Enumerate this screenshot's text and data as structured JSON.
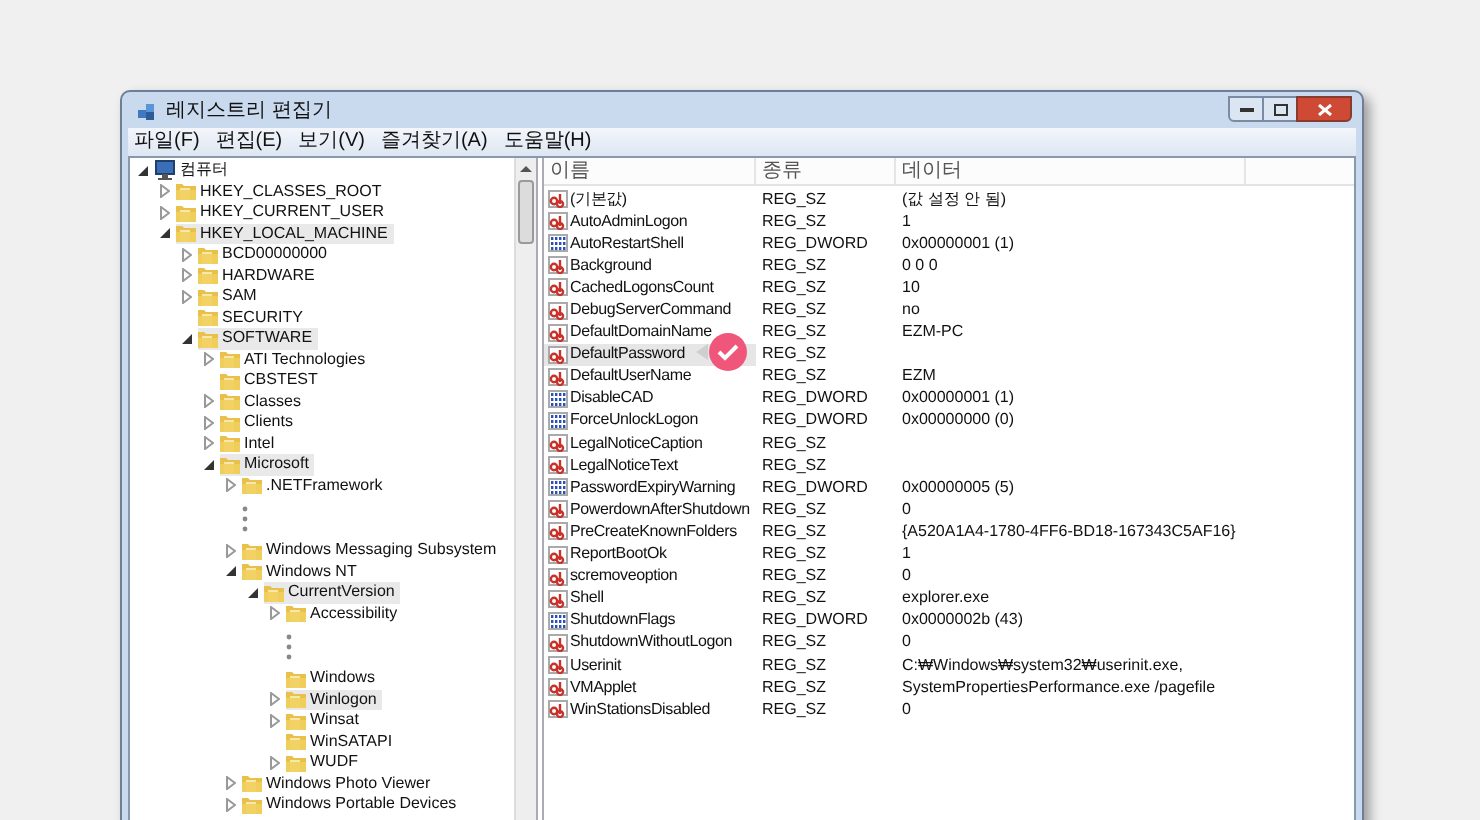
{
  "window": {
    "title": "레지스트리 편집기"
  },
  "menu": [
    "파일(F)",
    "편집(E)",
    "보기(V)",
    "즐겨찾기(A)",
    "도움말(H)"
  ],
  "tree": [
    {
      "kind": "computer",
      "label": "컴퓨터",
      "expandable": true,
      "expanded": true,
      "highlighted": false,
      "children": [
        {
          "kind": "folder",
          "label": "HKEY_CLASSES_ROOT",
          "expandable": true,
          "expanded": false,
          "highlighted": false
        },
        {
          "kind": "folder",
          "label": "HKEY_CURRENT_USER",
          "expandable": true,
          "expanded": false,
          "highlighted": false
        },
        {
          "kind": "folder",
          "label": "HKEY_LOCAL_MACHINE",
          "expandable": true,
          "expanded": true,
          "highlighted": true,
          "children": [
            {
              "kind": "folder",
              "label": "BCD00000000",
              "expandable": true,
              "expanded": false,
              "highlighted": false
            },
            {
              "kind": "folder",
              "label": "HARDWARE",
              "expandable": true,
              "expanded": false,
              "highlighted": false
            },
            {
              "kind": "folder",
              "label": "SAM",
              "expandable": true,
              "expanded": false,
              "highlighted": false
            },
            {
              "kind": "folder",
              "label": "SECURITY",
              "expandable": false,
              "highlighted": false
            },
            {
              "kind": "folder",
              "label": "SOFTWARE",
              "expandable": true,
              "expanded": true,
              "highlighted": true,
              "children": [
                {
                  "kind": "folder",
                  "label": "ATI Technologies",
                  "expandable": true,
                  "expanded": false,
                  "highlighted": false
                },
                {
                  "kind": "folder",
                  "label": "CBSTEST",
                  "expandable": false,
                  "highlighted": false
                },
                {
                  "kind": "folder",
                  "label": "Classes",
                  "expandable": true,
                  "expanded": false,
                  "highlighted": false
                },
                {
                  "kind": "folder",
                  "label": "Clients",
                  "expandable": true,
                  "expanded": false,
                  "highlighted": false
                },
                {
                  "kind": "folder",
                  "label": "Intel",
                  "expandable": true,
                  "expanded": false,
                  "highlighted": false
                },
                {
                  "kind": "folder",
                  "label": "Microsoft",
                  "expandable": true,
                  "expanded": true,
                  "highlighted": true,
                  "children": [
                    {
                      "kind": "folder",
                      "label": ".NETFramework",
                      "expandable": true,
                      "expanded": false,
                      "highlighted": false
                    },
                    {
                      "kind": "gap"
                    },
                    {
                      "kind": "folder",
                      "label": "Windows Messaging Subsystem",
                      "expandable": true,
                      "expanded": false,
                      "highlighted": false
                    },
                    {
                      "kind": "folder",
                      "label": "Windows NT",
                      "expandable": true,
                      "expanded": true,
                      "highlighted": false,
                      "children": [
                        {
                          "kind": "folder",
                          "label": "CurrentVersion",
                          "expandable": true,
                          "expanded": true,
                          "highlighted": true,
                          "children": [
                            {
                              "kind": "folder",
                              "label": "Accessibility",
                              "expandable": true,
                              "expanded": false,
                              "highlighted": false
                            },
                            {
                              "kind": "gap"
                            },
                            {
                              "kind": "folder",
                              "label": "Windows",
                              "expandable": false,
                              "highlighted": false
                            },
                            {
                              "kind": "folder",
                              "label": "Winlogon",
                              "expandable": true,
                              "expanded": false,
                              "highlighted": true
                            },
                            {
                              "kind": "folder",
                              "label": "Winsat",
                              "expandable": true,
                              "expanded": false,
                              "highlighted": false
                            },
                            {
                              "kind": "folder",
                              "label": "WinSATAPI",
                              "expandable": false,
                              "highlighted": false
                            },
                            {
                              "kind": "folder",
                              "label": "WUDF",
                              "expandable": true,
                              "expanded": false,
                              "highlighted": false
                            }
                          ]
                        }
                      ]
                    },
                    {
                      "kind": "folder",
                      "label": "Windows Photo Viewer",
                      "expandable": true,
                      "expanded": false,
                      "highlighted": false
                    },
                    {
                      "kind": "folder",
                      "label": "Windows Portable Devices",
                      "expandable": true,
                      "expanded": false,
                      "highlighted": false
                    }
                  ]
                }
              ]
            }
          ]
        }
      ]
    }
  ],
  "columns": [
    "이름",
    "종류",
    "데이터"
  ],
  "rows": [
    {
      "kind": "string",
      "name": "(기본값)",
      "type": "REG_SZ",
      "data": "(값 설정 안 됨)",
      "selected": false
    },
    {
      "kind": "string",
      "name": "AutoAdminLogon",
      "type": "REG_SZ",
      "data": "1",
      "selected": false
    },
    {
      "kind": "dword",
      "name": "AutoRestartShell",
      "type": "REG_DWORD",
      "data": "0x00000001 (1)",
      "selected": false
    },
    {
      "kind": "string",
      "name": "Background",
      "type": "REG_SZ",
      "data": "0 0 0",
      "selected": false
    },
    {
      "kind": "string",
      "name": "CachedLogonsCount",
      "type": "REG_SZ",
      "data": "10",
      "selected": false
    },
    {
      "kind": "string",
      "name": "DebugServerCommand",
      "type": "REG_SZ",
      "data": "no",
      "selected": false
    },
    {
      "kind": "string",
      "name": "DefaultDomainName",
      "type": "REG_SZ",
      "data": "EZM-PC",
      "selected": false
    },
    {
      "kind": "string",
      "name": "DefaultPassword",
      "type": "REG_SZ",
      "selected": true
    },
    {
      "kind": "string",
      "name": "DefaultUserName",
      "type": "REG_SZ",
      "data": "EZM",
      "selected": false
    },
    {
      "kind": "dword",
      "name": "DisableCAD",
      "type": "REG_DWORD",
      "data": "0x00000001 (1)",
      "selected": false
    },
    {
      "kind": "dword",
      "name": "ForceUnlockLogon",
      "type": "REG_DWORD",
      "data": "0x00000000 (0)",
      "selected": false
    },
    {
      "kind": "string",
      "name": "LegalNoticeCaption",
      "type": "REG_SZ",
      "selected": false
    },
    {
      "kind": "string",
      "name": "LegalNoticeText",
      "type": "REG_SZ",
      "selected": false
    },
    {
      "kind": "dword",
      "name": "PasswordExpiryWarning",
      "type": "REG_DWORD",
      "data": "0x00000005 (5)",
      "selected": false
    },
    {
      "kind": "string",
      "name": "PowerdownAfterShutdown",
      "type": "REG_SZ",
      "data": "0",
      "selected": false
    },
    {
      "kind": "string",
      "name": "PreCreateKnownFolders",
      "type": "REG_SZ",
      "data": "{A520A1A4-1780-4FF6-BD18-167343C5AF16}",
      "selected": false
    },
    {
      "kind": "string",
      "name": "ReportBootOk",
      "type": "REG_SZ",
      "data": "1",
      "selected": false
    },
    {
      "kind": "string",
      "name": "scremoveoption",
      "type": "REG_SZ",
      "data": "0",
      "selected": false
    },
    {
      "kind": "string",
      "name": "Shell",
      "type": "REG_SZ",
      "data": "explorer.exe",
      "selected": false
    },
    {
      "kind": "dword",
      "name": "ShutdownFlags",
      "type": "REG_DWORD",
      "data": "0x0000002b (43)",
      "selected": false
    },
    {
      "kind": "string",
      "name": "ShutdownWithoutLogon",
      "type": "REG_SZ",
      "data": "0",
      "selected": false
    },
    {
      "kind": "string",
      "name": "Userinit",
      "type": "REG_SZ",
      "data": "C:₩Windows₩system32₩userinit.exe,",
      "selected": false
    },
    {
      "kind": "string",
      "name": "VMApplet",
      "type": "REG_SZ",
      "data": "SystemPropertiesPerformance.exe /pagefile",
      "selected": false
    },
    {
      "kind": "string",
      "name": "WinStationsDisabled",
      "type": "REG_SZ",
      "data": "0",
      "selected": false
    }
  ]
}
